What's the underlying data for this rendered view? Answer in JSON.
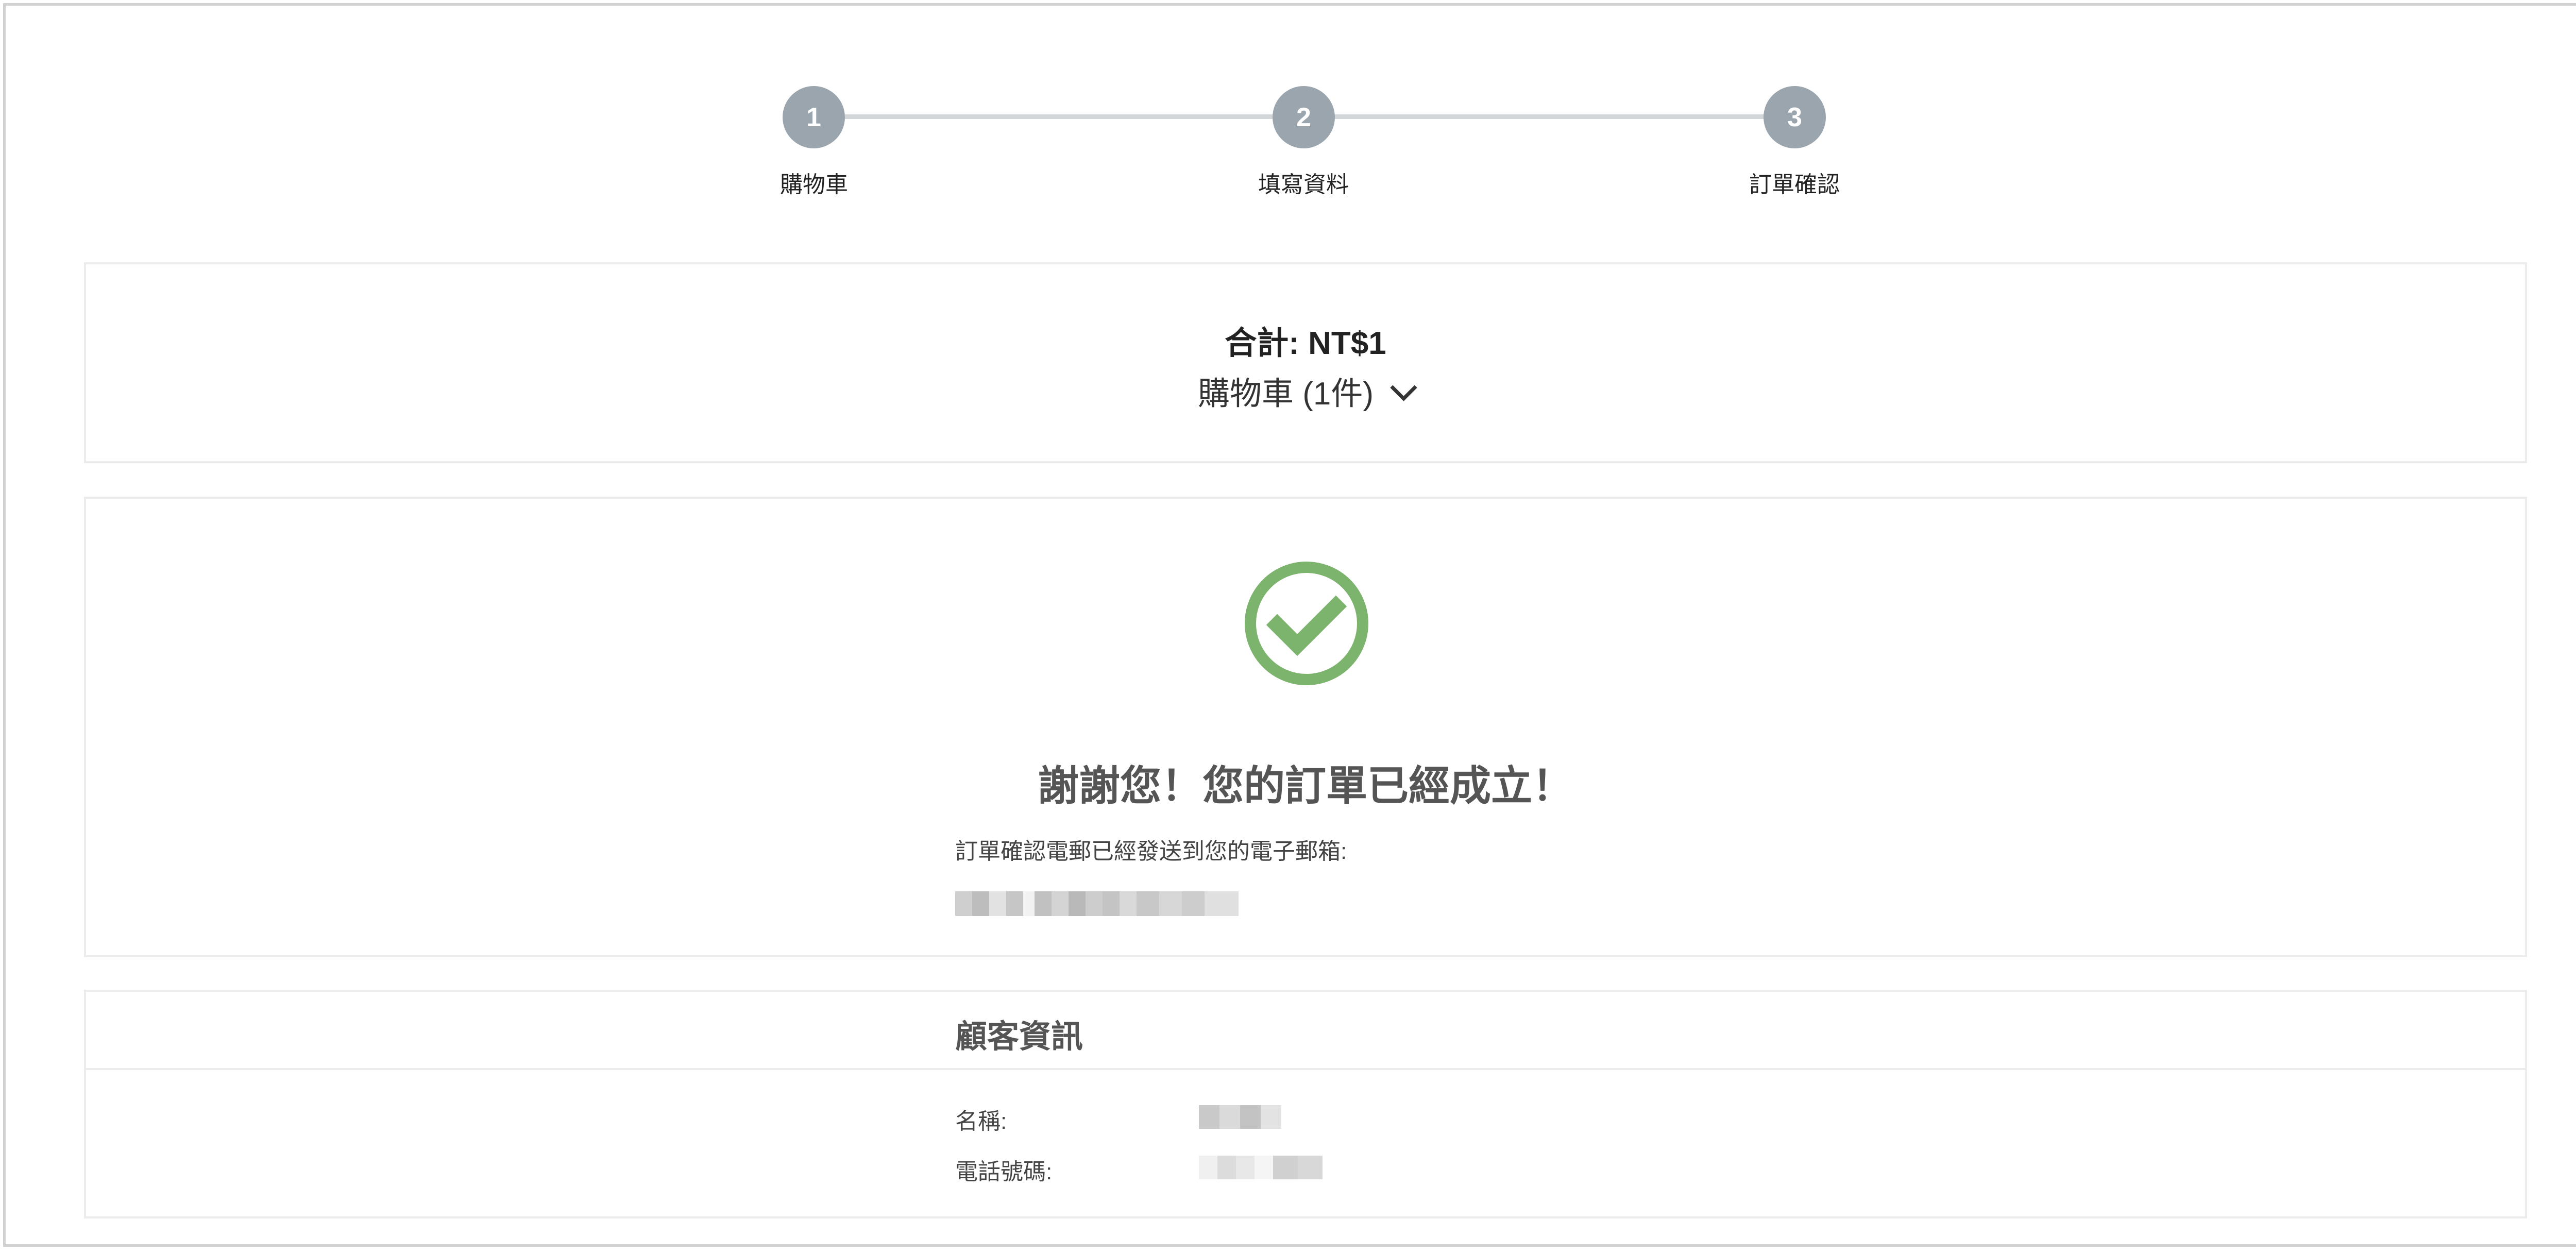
{
  "stepper": {
    "steps": [
      {
        "number": "1",
        "label": "購物車"
      },
      {
        "number": "2",
        "label": "填寫資料"
      },
      {
        "number": "3",
        "label": "訂單確認"
      }
    ]
  },
  "summary": {
    "total": "合計: NT$1",
    "cart": "購物車 (1件)"
  },
  "confirmation": {
    "title": "謝謝您！您的訂單已經成立！",
    "email_label": "訂單確認電郵已經發送到您的電子郵箱:"
  },
  "customer": {
    "title": "顧客資訊",
    "name_label": "名稱:",
    "phone_label": "電話號碼:"
  },
  "colors": {
    "success": "#7cb36d",
    "step": "#9aa5ad"
  }
}
